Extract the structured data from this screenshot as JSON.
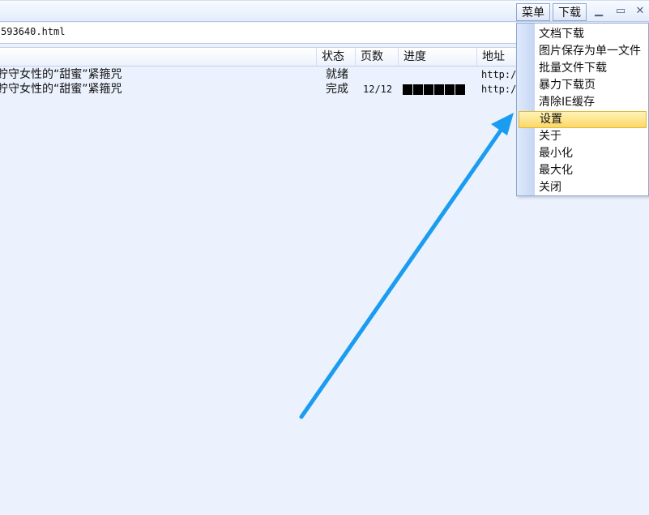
{
  "titlebar": {
    "menu_label": "菜单",
    "download_label": "下载",
    "minimize_glyph": "▁",
    "maximize_glyph": "▭",
    "close_glyph": "✕"
  },
  "url_bar": {
    "value": "593640.html"
  },
  "columns": {
    "name": "",
    "status": "状态",
    "pages": "页数",
    "progress": "进度",
    "address": "地址"
  },
  "rows": [
    {
      "name": "貯守女性的“甜蜜”紧箍咒",
      "status": "就绪",
      "pages": "",
      "progress": 0,
      "address": "http:/"
    },
    {
      "name": "貯守女性的“甜蜜”紧箍咒",
      "status": "完成",
      "pages": "12/12",
      "progress": 1.0,
      "address": "http:/"
    }
  ],
  "menu": {
    "items": [
      {
        "label": "文档下载",
        "selected": false
      },
      {
        "label": "图片保存为单一文件",
        "selected": false
      },
      {
        "label": "批量文件下载",
        "selected": false
      },
      {
        "label": "暴力下载页",
        "selected": false
      },
      {
        "label": "清除IE缓存",
        "selected": false
      },
      {
        "label": "设置",
        "selected": true
      },
      {
        "label": "关于",
        "selected": false
      },
      {
        "label": "最小化",
        "selected": false
      },
      {
        "label": "最大化",
        "selected": false
      },
      {
        "label": "关闭",
        "selected": false
      }
    ]
  },
  "colors": {
    "background": "#ebf1fd",
    "arrow": "#1a9cf0",
    "highlight": "#fcd866"
  }
}
